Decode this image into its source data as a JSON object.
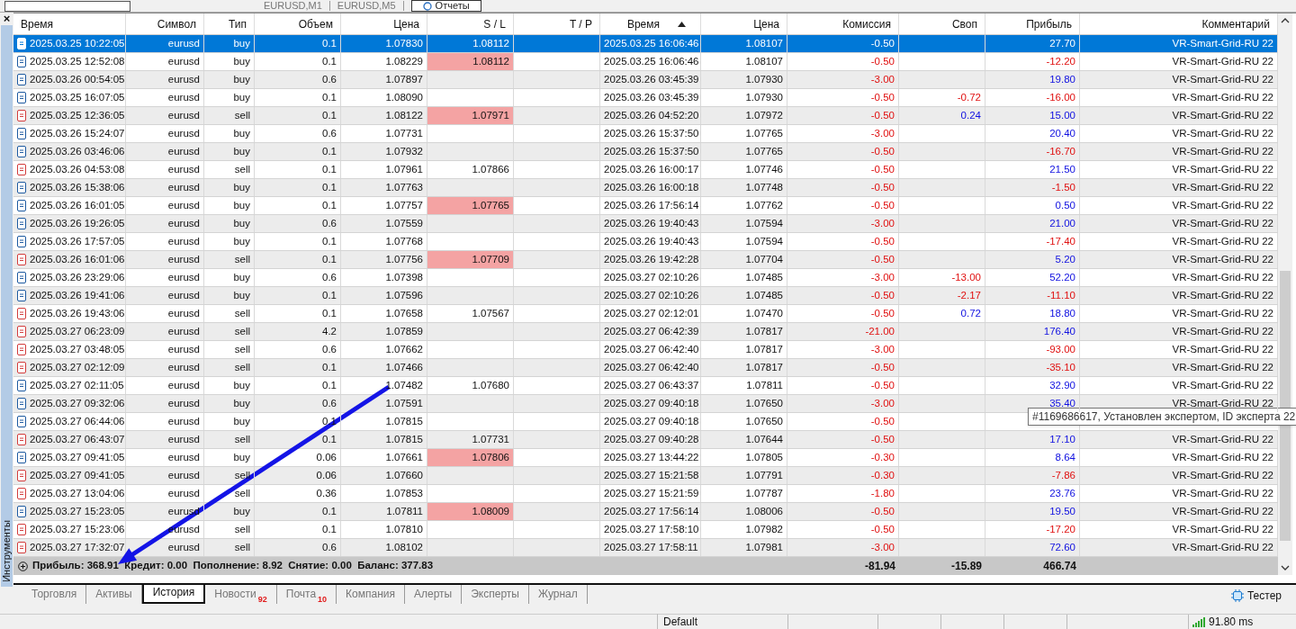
{
  "top_bar": {
    "tabs": [
      "EURUSD,M1",
      "EURUSD,M5"
    ],
    "reports_button": "Отчеты"
  },
  "side_panel": {
    "label": "Инструменты",
    "close": "×"
  },
  "table": {
    "columns": [
      {
        "label": "Время",
        "sorted": false
      },
      {
        "label": "Символ",
        "sorted": false
      },
      {
        "label": "Тип",
        "sorted": false
      },
      {
        "label": "Объем",
        "sorted": false
      },
      {
        "label": "Цена",
        "sorted": false
      },
      {
        "label": "S / L",
        "sorted": false
      },
      {
        "label": "T / P",
        "sorted": false
      },
      {
        "label": "Время",
        "sorted": true
      },
      {
        "label": "Цена",
        "sorted": false
      },
      {
        "label": "Комиссия",
        "sorted": false
      },
      {
        "label": "Своп",
        "sorted": false
      },
      {
        "label": "Прибыль",
        "sorted": false
      },
      {
        "label": "Комментарий",
        "sorted": false
      }
    ],
    "rows": [
      {
        "kind": "buy",
        "selected": true,
        "open_time": "2025.03.25 10:22:05",
        "symbol": "eurusd",
        "type": "buy",
        "volume": "0.1",
        "price": "1.07830",
        "sl": "1.08112",
        "sl_hit": false,
        "close_time": "2025.03.25 16:06:46",
        "close_price": "1.08107",
        "commission": "-0.50",
        "profit": {
          "value": "27.70"
        },
        "comment": "VR-Smart-Grid-RU 22"
      },
      {
        "kind": "buy",
        "selected": false,
        "open_time": "2025.03.25 12:52:08",
        "symbol": "eurusd",
        "type": "buy",
        "volume": "0.1",
        "price": "1.08229",
        "sl": "1.08112",
        "sl_hit": true,
        "close_time": "2025.03.25 16:06:46",
        "close_price": "1.08107",
        "commission": "-0.50",
        "profit": {
          "value": "-12.20",
          "negative": true
        },
        "comment": "VR-Smart-Grid-RU 22"
      },
      {
        "kind": "buy",
        "selected": false,
        "open_time": "2025.03.26 00:54:05",
        "symbol": "eurusd",
        "type": "buy",
        "volume": "0.6",
        "price": "1.07897",
        "sl_hit": false,
        "close_time": "2025.03.26 03:45:39",
        "close_price": "1.07930",
        "commission": "-3.00",
        "profit": {
          "value": "19.80",
          "negative": false
        },
        "comment": "VR-Smart-Grid-RU 22"
      },
      {
        "kind": "buy",
        "selected": false,
        "open_time": "2025.03.25 16:07:05",
        "symbol": "eurusd",
        "type": "buy",
        "volume": "0.1",
        "price": "1.08090",
        "sl_hit": false,
        "close_time": "2025.03.26 03:45:39",
        "close_price": "1.07930",
        "commission": "-0.50",
        "swap": {
          "value": "-0.72",
          "negative": true
        },
        "profit": {
          "value": "-16.00",
          "negative": true
        },
        "comment": "VR-Smart-Grid-RU 22"
      },
      {
        "kind": "sell",
        "selected": false,
        "open_time": "2025.03.25 12:36:05",
        "symbol": "eurusd",
        "type": "sell",
        "volume": "0.1",
        "price": "1.08122",
        "sl": "1.07971",
        "sl_hit": true,
        "close_time": "2025.03.26 04:52:20",
        "close_price": "1.07972",
        "commission": "-0.50",
        "swap": {
          "value": "0.24",
          "negative": false
        },
        "profit": {
          "value": "15.00",
          "negative": false
        },
        "comment": "VR-Smart-Grid-RU 22"
      },
      {
        "kind": "buy",
        "selected": false,
        "open_time": "2025.03.26 15:24:07",
        "symbol": "eurusd",
        "type": "buy",
        "volume": "0.6",
        "price": "1.07731",
        "sl_hit": false,
        "close_time": "2025.03.26 15:37:50",
        "close_price": "1.07765",
        "commission": "-3.00",
        "profit": {
          "value": "20.40",
          "negative": false
        },
        "comment": "VR-Smart-Grid-RU 22"
      },
      {
        "kind": "buy",
        "selected": false,
        "open_time": "2025.03.26 03:46:06",
        "symbol": "eurusd",
        "type": "buy",
        "volume": "0.1",
        "price": "1.07932",
        "sl_hit": false,
        "close_time": "2025.03.26 15:37:50",
        "close_price": "1.07765",
        "commission": "-0.50",
        "profit": {
          "value": "-16.70",
          "negative": true
        },
        "comment": "VR-Smart-Grid-RU 22"
      },
      {
        "kind": "sell",
        "selected": false,
        "open_time": "2025.03.26 04:53:08",
        "symbol": "eurusd",
        "type": "sell",
        "volume": "0.1",
        "price": "1.07961",
        "sl": "1.07866",
        "sl_hit": false,
        "close_time": "2025.03.26 16:00:17",
        "close_price": "1.07746",
        "commission": "-0.50",
        "profit": {
          "value": "21.50",
          "negative": false
        },
        "comment": "VR-Smart-Grid-RU 22"
      },
      {
        "kind": "buy",
        "selected": false,
        "open_time": "2025.03.26 15:38:06",
        "symbol": "eurusd",
        "type": "buy",
        "volume": "0.1",
        "price": "1.07763",
        "sl_hit": false,
        "close_time": "2025.03.26 16:00:18",
        "close_price": "1.07748",
        "commission": "-0.50",
        "profit": {
          "value": "-1.50",
          "negative": true
        },
        "comment": "VR-Smart-Grid-RU 22"
      },
      {
        "kind": "buy",
        "selected": false,
        "open_time": "2025.03.26 16:01:05",
        "symbol": "eurusd",
        "type": "buy",
        "volume": "0.1",
        "price": "1.07757",
        "sl": "1.07765",
        "sl_hit": true,
        "close_time": "2025.03.26 17:56:14",
        "close_price": "1.07762",
        "commission": "-0.50",
        "profit": {
          "value": "0.50",
          "negative": false
        },
        "comment": "VR-Smart-Grid-RU 22"
      },
      {
        "kind": "buy",
        "selected": false,
        "open_time": "2025.03.26 19:26:05",
        "symbol": "eurusd",
        "type": "buy",
        "volume": "0.6",
        "price": "1.07559",
        "sl_hit": false,
        "close_time": "2025.03.26 19:40:43",
        "close_price": "1.07594",
        "commission": "-3.00",
        "profit": {
          "value": "21.00",
          "negative": false
        },
        "comment": "VR-Smart-Grid-RU 22"
      },
      {
        "kind": "buy",
        "selected": false,
        "open_time": "2025.03.26 17:57:05",
        "symbol": "eurusd",
        "type": "buy",
        "volume": "0.1",
        "price": "1.07768",
        "sl_hit": false,
        "close_time": "2025.03.26 19:40:43",
        "close_price": "1.07594",
        "commission": "-0.50",
        "profit": {
          "value": "-17.40",
          "negative": true
        },
        "comment": "VR-Smart-Grid-RU 22"
      },
      {
        "kind": "sell",
        "selected": false,
        "open_time": "2025.03.26 16:01:06",
        "symbol": "eurusd",
        "type": "sell",
        "volume": "0.1",
        "price": "1.07756",
        "sl": "1.07709",
        "sl_hit": true,
        "close_time": "2025.03.26 19:42:28",
        "close_price": "1.07704",
        "commission": "-0.50",
        "profit": {
          "value": "5.20",
          "negative": false
        },
        "comment": "VR-Smart-Grid-RU 22"
      },
      {
        "kind": "buy",
        "selected": false,
        "open_time": "2025.03.26 23:29:06",
        "symbol": "eurusd",
        "type": "buy",
        "volume": "0.6",
        "price": "1.07398",
        "sl_hit": false,
        "close_time": "2025.03.27 02:10:26",
        "close_price": "1.07485",
        "commission": "-3.00",
        "swap": {
          "value": "-13.00",
          "negative": true
        },
        "profit": {
          "value": "52.20",
          "negative": false
        },
        "comment": "VR-Smart-Grid-RU 22"
      },
      {
        "kind": "buy",
        "selected": false,
        "open_time": "2025.03.26 19:41:06",
        "symbol": "eurusd",
        "type": "buy",
        "volume": "0.1",
        "price": "1.07596",
        "sl_hit": false,
        "close_time": "2025.03.27 02:10:26",
        "close_price": "1.07485",
        "commission": "-0.50",
        "swap": {
          "value": "-2.17",
          "negative": true
        },
        "profit": {
          "value": "-11.10",
          "negative": true
        },
        "comment": "VR-Smart-Grid-RU 22"
      },
      {
        "kind": "sell",
        "selected": false,
        "open_time": "2025.03.26 19:43:06",
        "symbol": "eurusd",
        "type": "sell",
        "volume": "0.1",
        "price": "1.07658",
        "sl": "1.07567",
        "sl_hit": false,
        "close_time": "2025.03.27 02:12:01",
        "close_price": "1.07470",
        "commission": "-0.50",
        "swap": {
          "value": "0.72",
          "negative": false
        },
        "profit": {
          "value": "18.80",
          "negative": false
        },
        "comment": "VR-Smart-Grid-RU 22"
      },
      {
        "kind": "sell",
        "selected": false,
        "open_time": "2025.03.27 06:23:09",
        "symbol": "eurusd",
        "type": "sell",
        "volume": "4.2",
        "price": "1.07859",
        "sl_hit": false,
        "close_time": "2025.03.27 06:42:39",
        "close_price": "1.07817",
        "commission": "-21.00",
        "profit": {
          "value": "176.40",
          "negative": false
        },
        "comment": "VR-Smart-Grid-RU 22"
      },
      {
        "kind": "sell",
        "selected": false,
        "open_time": "2025.03.27 03:48:05",
        "symbol": "eurusd",
        "type": "sell",
        "volume": "0.6",
        "price": "1.07662",
        "sl_hit": false,
        "close_time": "2025.03.27 06:42:40",
        "close_price": "1.07817",
        "commission": "-3.00",
        "profit": {
          "value": "-93.00",
          "negative": true
        },
        "comment": "VR-Smart-Grid-RU 22"
      },
      {
        "kind": "sell",
        "selected": false,
        "open_time": "2025.03.27 02:12:09",
        "symbol": "eurusd",
        "type": "sell",
        "volume": "0.1",
        "price": "1.07466",
        "sl_hit": false,
        "close_time": "2025.03.27 06:42:40",
        "close_price": "1.07817",
        "commission": "-0.50",
        "profit": {
          "value": "-35.10",
          "negative": true
        },
        "comment": "VR-Smart-Grid-RU 22"
      },
      {
        "kind": "buy",
        "selected": false,
        "open_time": "2025.03.27 02:11:05",
        "symbol": "eurusd",
        "type": "buy",
        "volume": "0.1",
        "price": "1.07482",
        "sl": "1.07680",
        "sl_hit": false,
        "close_time": "2025.03.27 06:43:37",
        "close_price": "1.07811",
        "commission": "-0.50",
        "profit": {
          "value": "32.90",
          "negative": false
        },
        "comment": "VR-Smart-Grid-RU 22"
      },
      {
        "kind": "buy",
        "selected": false,
        "open_time": "2025.03.27 09:32:06",
        "symbol": "eurusd",
        "type": "buy",
        "volume": "0.6",
        "price": "1.07591",
        "sl_hit": false,
        "close_time": "2025.03.27 09:40:18",
        "close_price": "1.07650",
        "commission": "-3.00",
        "profit": {
          "value": "35.40",
          "negative": false
        },
        "comment": "VR-Smart-Grid-RU 22"
      },
      {
        "kind": "buy",
        "selected": false,
        "open_time": "2025.03.27 06:44:06",
        "symbol": "eurusd",
        "type": "buy",
        "volume": "0.1",
        "price": "1.07815",
        "sl_hit": false,
        "close_time": "2025.03.27 09:40:18",
        "close_price": "1.07650",
        "commission": "-0.50"
      },
      {
        "kind": "sell",
        "selected": false,
        "open_time": "2025.03.27 06:43:07",
        "symbol": "eurusd",
        "type": "sell",
        "volume": "0.1",
        "price": "1.07815",
        "sl": "1.07731",
        "sl_hit": false,
        "close_time": "2025.03.27 09:40:28",
        "close_price": "1.07644",
        "commission": "-0.50",
        "profit": {
          "value": "17.10",
          "negative": false
        },
        "comment": "VR-Smart-Grid-RU 22"
      },
      {
        "kind": "buy",
        "selected": false,
        "open_time": "2025.03.27 09:41:05",
        "symbol": "eurusd",
        "type": "buy",
        "volume": "0.06",
        "price": "1.07661",
        "sl": "1.07806",
        "sl_hit": true,
        "close_time": "2025.03.27 13:44:22",
        "close_price": "1.07805",
        "commission": "-0.30",
        "profit": {
          "value": "8.64",
          "negative": false
        },
        "comment": "VR-Smart-Grid-RU 22"
      },
      {
        "kind": "sell",
        "selected": false,
        "open_time": "2025.03.27 09:41:05",
        "symbol": "eurusd",
        "type": "sell",
        "volume": "0.06",
        "price": "1.07660",
        "sl_hit": false,
        "close_time": "2025.03.27 15:21:58",
        "close_price": "1.07791",
        "commission": "-0.30",
        "profit": {
          "value": "-7.86",
          "negative": true
        },
        "comment": "VR-Smart-Grid-RU 22"
      },
      {
        "kind": "sell",
        "selected": false,
        "open_time": "2025.03.27 13:04:06",
        "symbol": "eurusd",
        "type": "sell",
        "volume": "0.36",
        "price": "1.07853",
        "sl_hit": false,
        "close_time": "2025.03.27 15:21:59",
        "close_price": "1.07787",
        "commission": "-1.80",
        "profit": {
          "value": "23.76",
          "negative": false
        },
        "comment": "VR-Smart-Grid-RU 22"
      },
      {
        "kind": "buy",
        "selected": false,
        "open_time": "2025.03.27 15:23:05",
        "symbol": "eurusd",
        "type": "buy",
        "volume": "0.1",
        "price": "1.07811",
        "sl": "1.08009",
        "sl_hit": true,
        "close_time": "2025.03.27 17:56:14",
        "close_price": "1.08006",
        "commission": "-0.50",
        "profit": {
          "value": "19.50",
          "negative": false
        },
        "comment": "VR-Smart-Grid-RU 22"
      },
      {
        "kind": "sell",
        "selected": false,
        "open_time": "2025.03.27 15:23:06",
        "symbol": "eurusd",
        "type": "sell",
        "volume": "0.1",
        "price": "1.07810",
        "sl_hit": false,
        "close_time": "2025.03.27 17:58:10",
        "close_price": "1.07982",
        "commission": "-0.50",
        "profit": {
          "value": "-17.20",
          "negative": true
        },
        "comment": "VR-Smart-Grid-RU 22"
      },
      {
        "kind": "sell",
        "selected": false,
        "open_time": "2025.03.27 17:32:07",
        "symbol": "eurusd",
        "type": "sell",
        "volume": "0.6",
        "price": "1.08102",
        "sl_hit": false,
        "close_time": "2025.03.27 17:58:11",
        "close_price": "1.07981",
        "commission": "-3.00",
        "profit": {
          "value": "72.60",
          "negative": false
        },
        "comment": "VR-Smart-Grid-RU 22"
      }
    ],
    "summary": {
      "text": "Прибыль: 368.91  Кредит: 0.00  Пополнение: 8.92  Снятие: 0.00  Баланс: 377.83",
      "commission_total": "-81.94",
      "swap_total": "-15.89",
      "profit_total": "466.74"
    }
  },
  "tooltip": "#1169686617, Установлен экспертом, ID эксперта 22",
  "bottom_tabs": [
    {
      "label": "Торговля",
      "selected": false
    },
    {
      "label": "Активы",
      "selected": false
    },
    {
      "label": "История",
      "selected": true
    },
    {
      "label": "Новости",
      "badge": "92",
      "selected": false
    },
    {
      "label": "Почта",
      "badge": "10",
      "selected": false
    },
    {
      "label": "Компания",
      "selected": false
    },
    {
      "label": "Алерты",
      "selected": false
    },
    {
      "label": "Эксперты",
      "selected": false
    },
    {
      "label": "Журнал",
      "selected": false
    }
  ],
  "tester_button": "Тестер",
  "status_bar": {
    "profile": "Default",
    "ping": "91.80 ms"
  }
}
